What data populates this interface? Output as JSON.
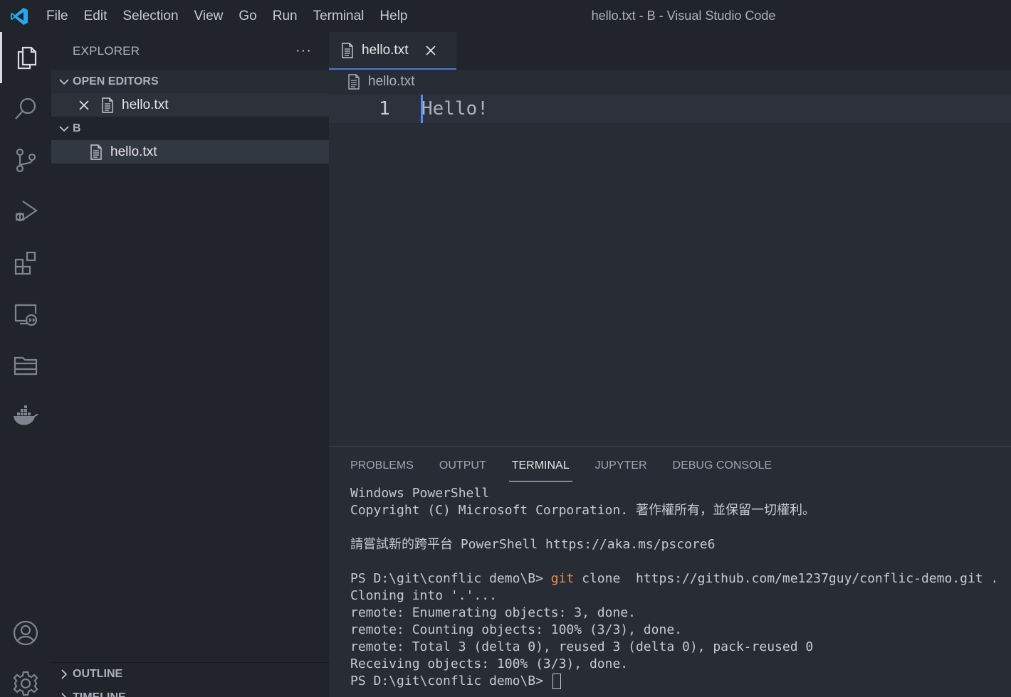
{
  "titlebar": {
    "menus": [
      "File",
      "Edit",
      "Selection",
      "View",
      "Go",
      "Run",
      "Terminal",
      "Help"
    ],
    "window_title": "hello.txt - B - Visual Studio Code"
  },
  "activity_bar": {
    "items": [
      "explorer-icon",
      "search-icon",
      "source-control-icon",
      "run-debug-icon",
      "extensions-icon",
      "remote-explorer-icon",
      "folder-icon",
      "docker-icon"
    ],
    "bottom": [
      "account-icon",
      "settings-gear-icon"
    ]
  },
  "sidebar": {
    "title": "EXPLORER",
    "more": "···",
    "open_editors": {
      "label": "OPEN EDITORS",
      "files": [
        "hello.txt"
      ]
    },
    "folder": {
      "label": "B",
      "files": [
        "hello.txt"
      ]
    },
    "outline_label": "OUTLINE",
    "timeline_label": "TIMELINE"
  },
  "editor": {
    "tab_label": "hello.txt",
    "breadcrumb": "hello.txt",
    "line_number": "1",
    "code": "Hello!"
  },
  "panel": {
    "tabs": [
      "PROBLEMS",
      "OUTPUT",
      "TERMINAL",
      "JUPYTER",
      "DEBUG CONSOLE"
    ],
    "active_tab": "TERMINAL",
    "terminal": {
      "line1": "Windows PowerShell",
      "line2": "Copyright (C) Microsoft Corporation. 著作權所有，並保留一切權利。",
      "line3": "請嘗試新的跨平台 PowerShell https://aka.ms/pscore6",
      "prompt1": "PS D:\\git\\conflic demo\\B> ",
      "cmd_git": "git",
      "cmd_rest": " clone  https://github.com/me1237guy/conflic-demo.git .",
      "line5": "Cloning into '.'...",
      "line6": "remote: Enumerating objects: 3, done.",
      "line7": "remote: Counting objects: 100% (3/3), done.",
      "line8": "remote: Total 3 (delta 0), reused 3 (delta 0), pack-reused 0",
      "line9": "Receiving objects: 100% (3/3), done.",
      "prompt2": "PS D:\\git\\conflic demo\\B> "
    }
  },
  "colors": {
    "accent": "#4d78cc",
    "vscode_blue": "#23a9f2",
    "git_command": "#e5904f"
  }
}
